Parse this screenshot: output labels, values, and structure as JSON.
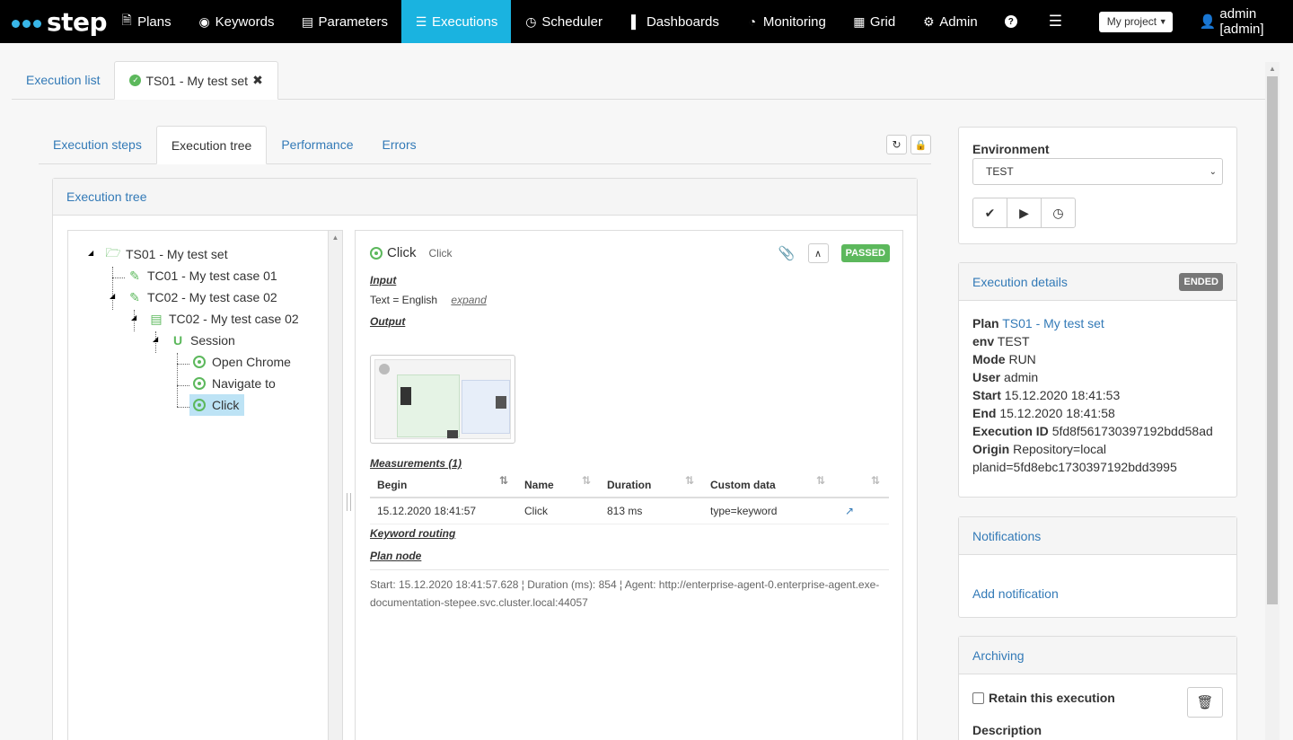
{
  "nav": {
    "logo_text": "step",
    "items": [
      {
        "label": "Plans",
        "icon": "file-icon"
      },
      {
        "label": "Keywords",
        "icon": "target-icon"
      },
      {
        "label": "Parameters",
        "icon": "list-icon"
      },
      {
        "label": "Executions",
        "icon": "tasks-icon"
      },
      {
        "label": "Scheduler",
        "icon": "clock-icon"
      },
      {
        "label": "Dashboards",
        "icon": "bar-chart-icon"
      },
      {
        "label": "Monitoring",
        "icon": "dashboard-icon"
      },
      {
        "label": "Grid",
        "icon": "grid-icon"
      },
      {
        "label": "Admin",
        "icon": "cog-icon"
      }
    ],
    "active": "Executions",
    "project_select": "My project",
    "user": "admin [admin]"
  },
  "top_tabs": {
    "list_label": "Execution list",
    "exec_label": "TS01 - My test set"
  },
  "sub_tabs": [
    "Execution steps",
    "Execution tree",
    "Performance",
    "Errors"
  ],
  "tree_panel": {
    "title": "Execution tree",
    "nodes": [
      {
        "label": "TS01 - My test set"
      },
      {
        "label": "TC01 - My test case 01"
      },
      {
        "label": "TC02 - My test case 02"
      },
      {
        "label": "TC02 - My test case 02"
      },
      {
        "label": "Session"
      },
      {
        "label": "Open Chrome"
      },
      {
        "label": "Navigate to"
      },
      {
        "label": "Click"
      }
    ]
  },
  "detail": {
    "title": "Click",
    "subtitle": "Click",
    "status": "PASSED",
    "input_heading": "Input",
    "input_text": "Text = English",
    "expand_link": "expand",
    "output_heading": "Output",
    "measurements_heading": "Measurements (1)",
    "columns": [
      "Begin",
      "Name",
      "Duration",
      "Custom data"
    ],
    "rows": [
      {
        "begin": "15.12.2020 18:41:57",
        "name": "Click",
        "duration": "813 ms",
        "custom": "type=keyword"
      }
    ],
    "keyword_routing_heading": "Keyword routing",
    "plan_node_heading": "Plan node",
    "agent_info": "Start: 15.12.2020 18:41:57.628 ¦ Duration (ms): 854 ¦ Agent: http://enterprise-agent-0.enterprise-agent.exe-documentation-stepee.svc.cluster.local:44057"
  },
  "environment": {
    "label": "Environment",
    "value": "TEST"
  },
  "execution_details": {
    "title": "Execution details",
    "badge": "ENDED",
    "plan_key": "Plan",
    "plan_value": "TS01 - My test set",
    "env_key": "env",
    "env_value": "TEST",
    "mode_key": "Mode",
    "mode_value": "RUN",
    "user_key": "User",
    "user_value": "admin",
    "start_key": "Start",
    "start_value": "15.12.2020 18:41:53",
    "end_key": "End",
    "end_value": "15.12.2020 18:41:58",
    "id_key": "Execution ID",
    "id_value": "5fd8f561730397192bdd58ad",
    "origin_key": "Origin",
    "origin_value": "Repository=local",
    "origin_value2": "planid=5fd8ebc1730397192bdd3995"
  },
  "notifications": {
    "title": "Notifications",
    "add_label": "Add notification"
  },
  "archiving": {
    "title": "Archiving",
    "retain_label": "Retain this execution",
    "description_label": "Description"
  },
  "colors": {
    "accent": "#1ab3e0",
    "success": "#5cb85c",
    "link": "#337ab7",
    "ended": "#777777"
  }
}
